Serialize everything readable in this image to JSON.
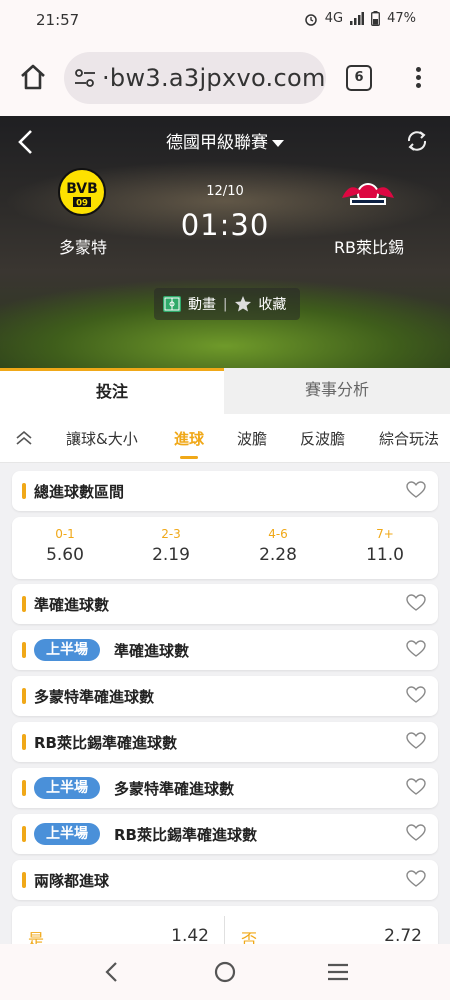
{
  "status_bar": {
    "time": "21:57",
    "network": "4G",
    "battery": "47%"
  },
  "browser": {
    "url": "·bw3.a3jpxvo.com",
    "tab_count": "6"
  },
  "match": {
    "league": "德國甲級聯賽",
    "date": "12/10",
    "time": "01:30",
    "home_team": "多蒙特",
    "away_team": "RB萊比錫",
    "home_logo_text": "BVB",
    "home_logo_sub": "09",
    "animation_label": "動畫",
    "favorite_label": "收藏"
  },
  "main_tabs": [
    {
      "label": "投注"
    },
    {
      "label": "賽事分析"
    }
  ],
  "sub_tabs": [
    {
      "label": "讓球&大小"
    },
    {
      "label": "進球"
    },
    {
      "label": "波膽"
    },
    {
      "label": "反波膽"
    },
    {
      "label": "綜合玩法"
    }
  ],
  "active_sub_tab": "進球",
  "markets": {
    "total_goals_range": {
      "title": "總進球數區間",
      "odds": [
        {
          "range": "0-1",
          "value": "5.60"
        },
        {
          "range": "2-3",
          "value": "2.19"
        },
        {
          "range": "4-6",
          "value": "2.28"
        },
        {
          "range": "7+",
          "value": "11.0"
        }
      ]
    },
    "exact_goals": {
      "title": "準確進球數"
    },
    "first_half_exact_goals": {
      "badge": "上半場",
      "title": "準確進球數"
    },
    "home_exact_goals": {
      "title": "多蒙特準確進球數"
    },
    "away_exact_goals": {
      "title": "RB萊比錫準確進球數"
    },
    "first_half_home_exact_goals": {
      "badge": "上半場",
      "title": "多蒙特準確進球數"
    },
    "first_half_away_exact_goals": {
      "badge": "上半場",
      "title": "RB萊比錫準確進球數"
    },
    "both_teams_score": {
      "title": "兩隊都進球",
      "yes_label": "是",
      "yes_value": "1.42",
      "no_label": "否",
      "no_value": "2.72"
    }
  },
  "colors": {
    "accent": "#f0a818",
    "badge_blue": "#4a90d9",
    "home_yellow": "#fde100",
    "away_red": "#dd0741"
  }
}
